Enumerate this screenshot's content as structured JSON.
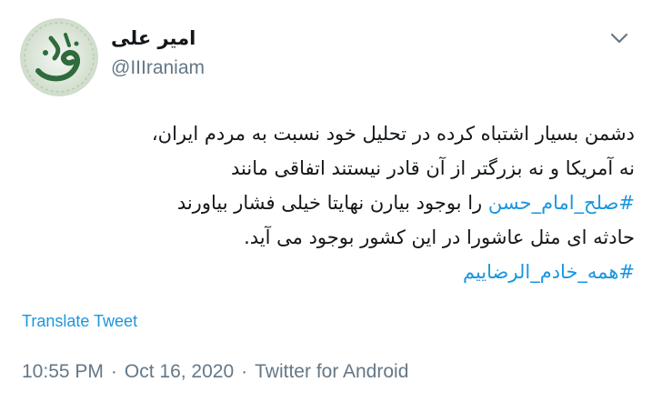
{
  "user": {
    "display_name": "امیر علی",
    "handle": "@IIIraniam",
    "avatar_icon": "calligraphy-avatar"
  },
  "tweet": {
    "line1": "دشمن بسیار اشتباه کرده در تحلیل خود نسبت به مردم ایران،",
    "line2": "نه آمریکا  و نه بزرگتر از آن قادر نیستند  اتفاقی مانند",
    "line3_hashtag": "#صلح_امام_حسن",
    "line3_text": "را بوجود بیارن نهایتا خیلی فشار بیاورند",
    "line4": "حادثه ای مثل عاشورا در این کشور بوجود می آید.",
    "line5_hashtag": "#همه_خادم_الرضاییم"
  },
  "translate_label": "Translate Tweet",
  "meta": {
    "time": "10:55 PM",
    "separator": "·",
    "date": "Oct 16, 2020",
    "source": "Twitter for Android"
  },
  "colors": {
    "link": "#1b95e0",
    "secondary": "#657786",
    "text": "#14171a"
  }
}
